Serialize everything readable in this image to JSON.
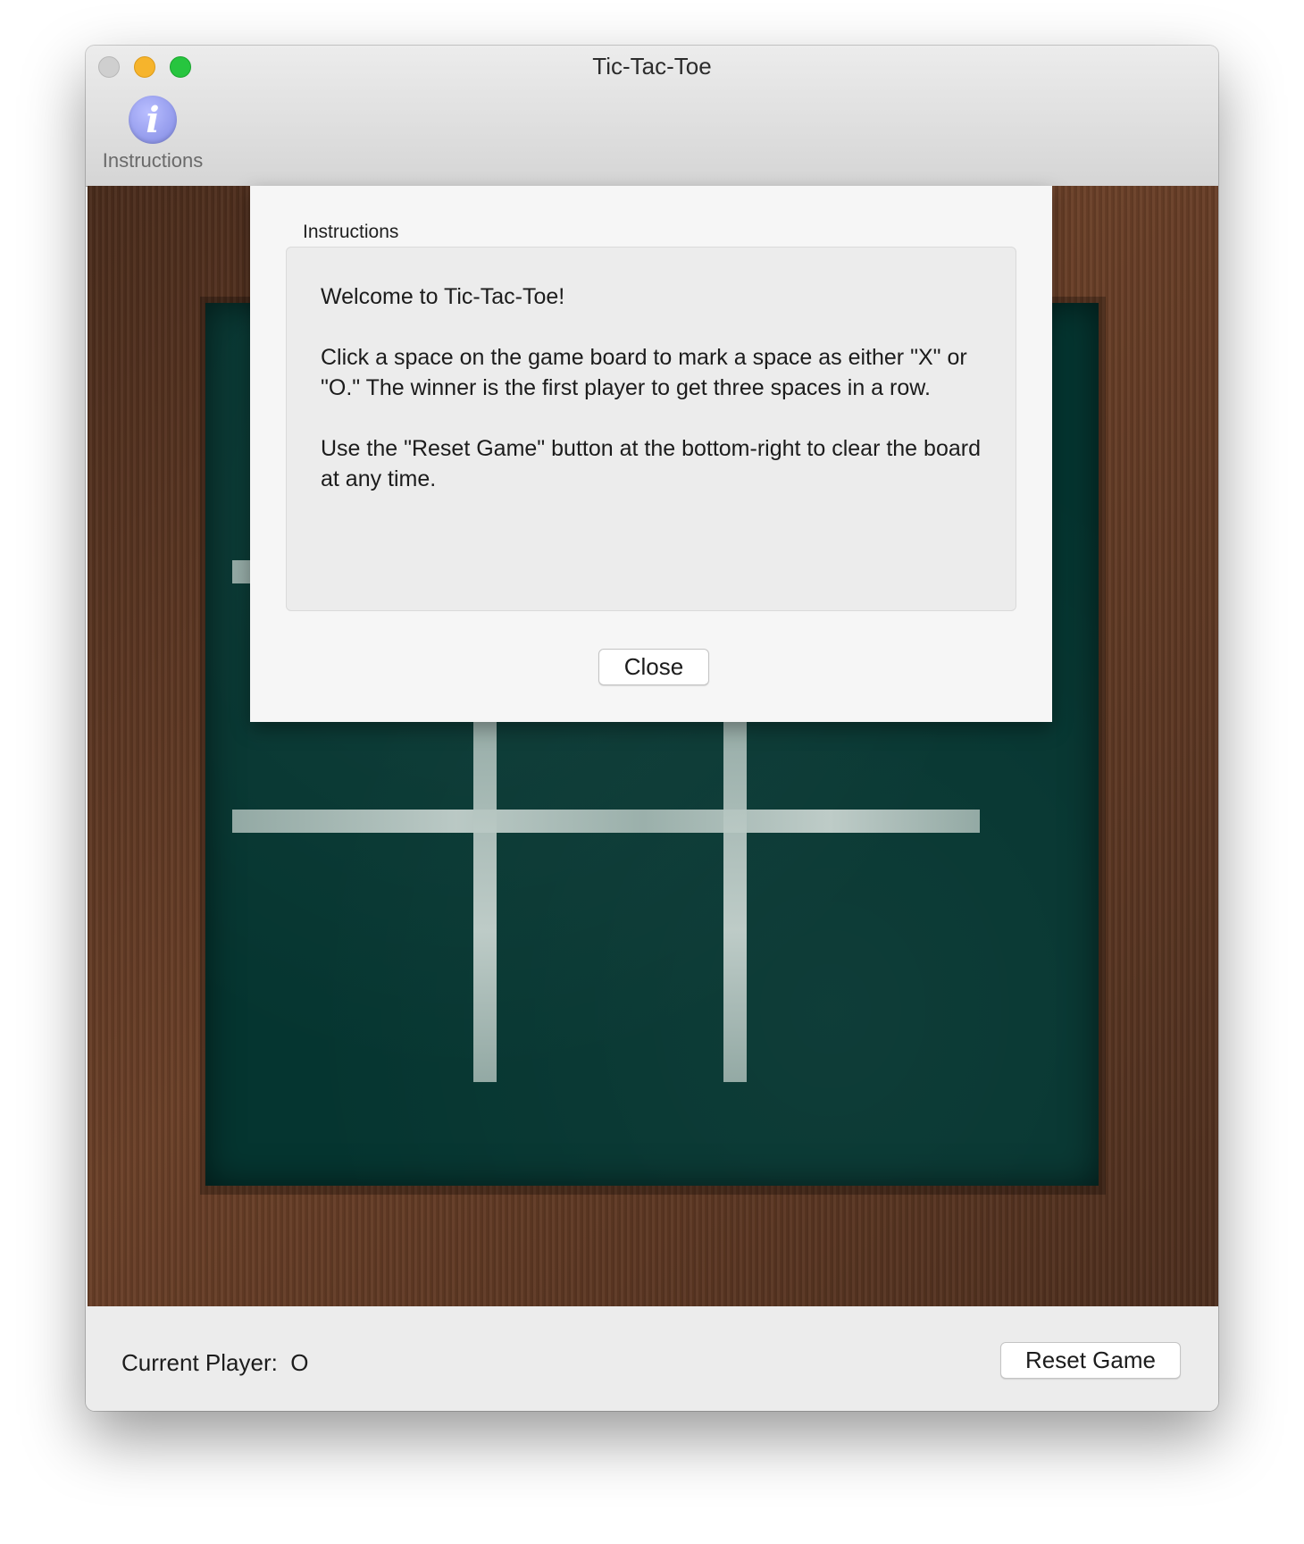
{
  "window": {
    "title": "Tic-Tac-Toe"
  },
  "toolbar": {
    "instructions_icon_glyph": "i",
    "instructions_label": "Instructions"
  },
  "board": {
    "cells": [
      "",
      "",
      "",
      "",
      "",
      "",
      "",
      "",
      ""
    ]
  },
  "sheet": {
    "group_title": "Instructions",
    "paragraphs": [
      "Welcome to Tic-Tac-Toe!",
      "Click a space on the game board to mark a space as either \"X\" or \"O.\" The winner is the first player to get three spaces in a row.",
      "Use the \"Reset Game\" button at the bottom-right to clear the board at any time."
    ],
    "close_label": "Close"
  },
  "footer": {
    "current_player_label": "Current Player:",
    "current_player_value": "O",
    "reset_label": "Reset Game"
  },
  "colors": {
    "chalkboard": "#053530",
    "frame_wood": "#5a3522",
    "chalk": "#b9c8c4",
    "info_icon": "#8f97ee"
  },
  "icons": {
    "instructions": "info-icon"
  }
}
